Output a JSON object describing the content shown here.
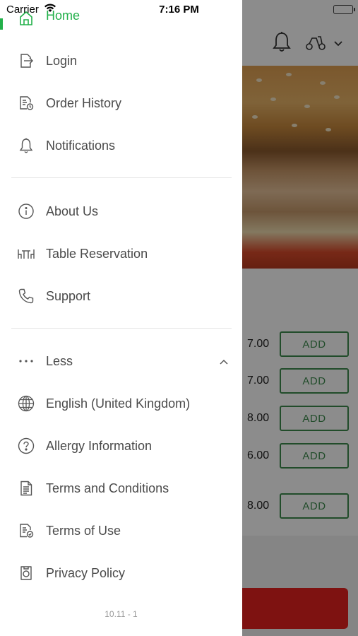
{
  "status_bar": {
    "carrier": "Carrier",
    "time": "7:16 PM"
  },
  "menu": {
    "home": "Home",
    "items_group1": [
      {
        "label": "Login",
        "icon": "login-icon"
      },
      {
        "label": "Order History",
        "icon": "order-history-icon"
      },
      {
        "label": "Notifications",
        "icon": "bell-icon"
      }
    ],
    "items_group2": [
      {
        "label": "About Us",
        "icon": "info-icon"
      },
      {
        "label": "Table Reservation",
        "icon": "table-icon"
      },
      {
        "label": "Support",
        "icon": "phone-icon"
      }
    ],
    "less_label": "Less",
    "items_group3": [
      {
        "label": "English (United Kingdom)",
        "icon": "globe-icon"
      },
      {
        "label": "Allergy Information",
        "icon": "question-icon"
      },
      {
        "label": "Terms and Conditions",
        "icon": "document-icon"
      },
      {
        "label": "Terms of Use",
        "icon": "document-check-icon"
      },
      {
        "label": "Privacy Policy",
        "icon": "privacy-icon"
      }
    ],
    "version": "10.11 - 1"
  },
  "background": {
    "prices": [
      "7.00",
      "7.00",
      "8.00",
      "6.00",
      "8.00"
    ],
    "add_label": "ADD",
    "accent": "#22b04a",
    "add_button_color": "#3d8a4e",
    "cart_bar_color": "#e6211f"
  }
}
